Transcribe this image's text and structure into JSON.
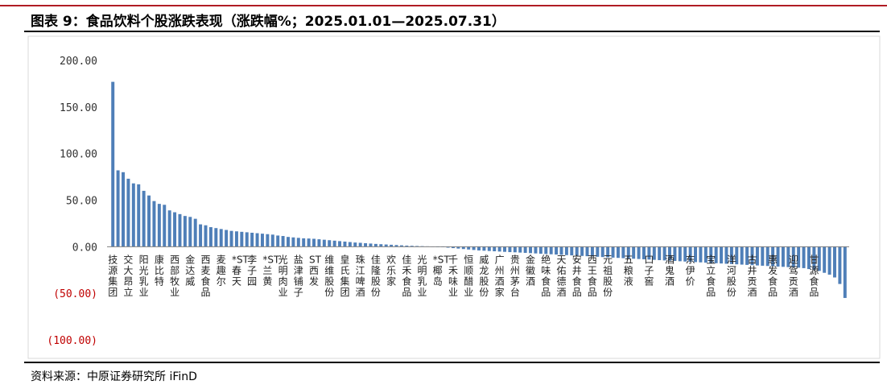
{
  "title": "图表 9：食品饮料个股涨跌表现（涨跌幅%；2025.01.01—2025.07.31）",
  "source": "资料来源：中原证券研究所 iFinD",
  "colors": {
    "bar": "#4f7fb8",
    "bar_edge": "#3a679c",
    "negative_label": "#c00000",
    "accent_line": "#b01c24"
  },
  "chart_data": {
    "type": "bar",
    "title": "",
    "xlabel": "",
    "ylabel": "",
    "ylim": [
      -100,
      200
    ],
    "yticks": [
      200,
      150,
      100,
      50,
      0,
      -50,
      -100
    ],
    "ytick_labels": [
      "200.00",
      "150.00",
      "100.00",
      "50.00",
      "0.00",
      "(50.00)",
      "(100.00)"
    ],
    "grid": false,
    "bar_count": 143,
    "categories": [
      {
        "i": 0,
        "label": "技源集团"
      },
      {
        "i": 3,
        "label": "交大昂立"
      },
      {
        "i": 6,
        "label": "阳光乳业"
      },
      {
        "i": 9,
        "label": "康比特"
      },
      {
        "i": 12,
        "label": "西部牧业"
      },
      {
        "i": 15,
        "label": "金达威"
      },
      {
        "i": 18,
        "label": "西麦食品"
      },
      {
        "i": 21,
        "label": "麦趣尔"
      },
      {
        "i": 24,
        "label": "*ST春天"
      },
      {
        "i": 27,
        "label": "李子园"
      },
      {
        "i": 30,
        "label": "*ST兰黄"
      },
      {
        "i": 33,
        "label": "光明肉业"
      },
      {
        "i": 36,
        "label": "盐津铺子"
      },
      {
        "i": 39,
        "label": "ST西发"
      },
      {
        "i": 42,
        "label": "维维股份"
      },
      {
        "i": 45,
        "label": "皇氏集团"
      },
      {
        "i": 48,
        "label": "珠江啤酒"
      },
      {
        "i": 51,
        "label": "佳隆股份"
      },
      {
        "i": 54,
        "label": "欢乐家"
      },
      {
        "i": 57,
        "label": "佳禾食品"
      },
      {
        "i": 60,
        "label": "光明乳业"
      },
      {
        "i": 63,
        "label": "*ST椰岛"
      },
      {
        "i": 66,
        "label": "千禾味业"
      },
      {
        "i": 69,
        "label": "恒顺醋业"
      },
      {
        "i": 72,
        "label": "威龙股份"
      },
      {
        "i": 75,
        "label": "广州酒家"
      },
      {
        "i": 78,
        "label": "贵州茅台"
      },
      {
        "i": 81,
        "label": "金徽酒"
      },
      {
        "i": 84,
        "label": "绝味食品"
      },
      {
        "i": 87,
        "label": "天佑德酒"
      },
      {
        "i": 90,
        "label": "安井食品"
      },
      {
        "i": 93,
        "label": "西王食品"
      },
      {
        "i": 96,
        "label": "元祖股份"
      },
      {
        "i": 100,
        "label": "五粮液"
      },
      {
        "i": 104,
        "label": "口子窖"
      },
      {
        "i": 108,
        "label": "酒鬼酒"
      },
      {
        "i": 112,
        "label": "东伊价"
      },
      {
        "i": 116,
        "label": "宝立食品"
      },
      {
        "i": 120,
        "label": "洋河股份"
      },
      {
        "i": 124,
        "label": "古井贡酒"
      },
      {
        "i": 128,
        "label": "惠发食品"
      },
      {
        "i": 132,
        "label": "迎驾贡酒"
      },
      {
        "i": 136,
        "label": "甘源食品"
      }
    ],
    "values": [
      177.0,
      82.0,
      80.0,
      73.0,
      68.0,
      67.0,
      60.0,
      55.0,
      49.0,
      46.0,
      45.0,
      39.0,
      37.0,
      35.0,
      33.0,
      32.0,
      30.0,
      24.0,
      23.0,
      21.0,
      20.0,
      19.0,
      18.0,
      17.0,
      16.5,
      16.0,
      15.5,
      15.0,
      14.5,
      14.0,
      13.5,
      13.0,
      12.0,
      11.5,
      10.5,
      10.0,
      9.5,
      9.0,
      8.8,
      8.5,
      8.0,
      7.5,
      7.0,
      6.5,
      6.0,
      5.5,
      5.0,
      4.5,
      4.2,
      3.8,
      3.4,
      3.0,
      2.7,
      2.4,
      2.1,
      1.8,
      1.5,
      1.2,
      1.0,
      0.8,
      0.6,
      0.4,
      0.2,
      0.0,
      -0.5,
      -1.0,
      -1.5,
      -2.0,
      -2.5,
      -3.0,
      -3.5,
      -4.0,
      -4.3,
      -4.6,
      -4.9,
      -5.2,
      -5.5,
      -5.8,
      -6.0,
      -6.3,
      -6.6,
      -6.9,
      -7.2,
      -7.5,
      -7.8,
      -8.1,
      -8.4,
      -8.7,
      -9.0,
      -9.3,
      -9.6,
      -9.9,
      -10.2,
      -10.5,
      -10.8,
      -11.1,
      -11.4,
      -11.7,
      -12.0,
      -12.3,
      -12.6,
      -12.9,
      -13.2,
      -13.5,
      -13.8,
      -14.1,
      -14.4,
      -14.7,
      -15.0,
      -15.3,
      -15.6,
      -15.9,
      -16.2,
      -16.5,
      -16.8,
      -17.1,
      -17.4,
      -17.7,
      -18.0,
      -18.3,
      -18.6,
      -18.9,
      -19.2,
      -19.5,
      -19.8,
      -20.1,
      -20.4,
      -20.7,
      -21.0,
      -21.3,
      -21.6,
      -21.9,
      -22.2,
      -22.5,
      -23.0,
      -24.0,
      -25.0,
      -26.0,
      -28.0,
      -30.0,
      -33.0,
      -40.0,
      -55.0
    ]
  }
}
